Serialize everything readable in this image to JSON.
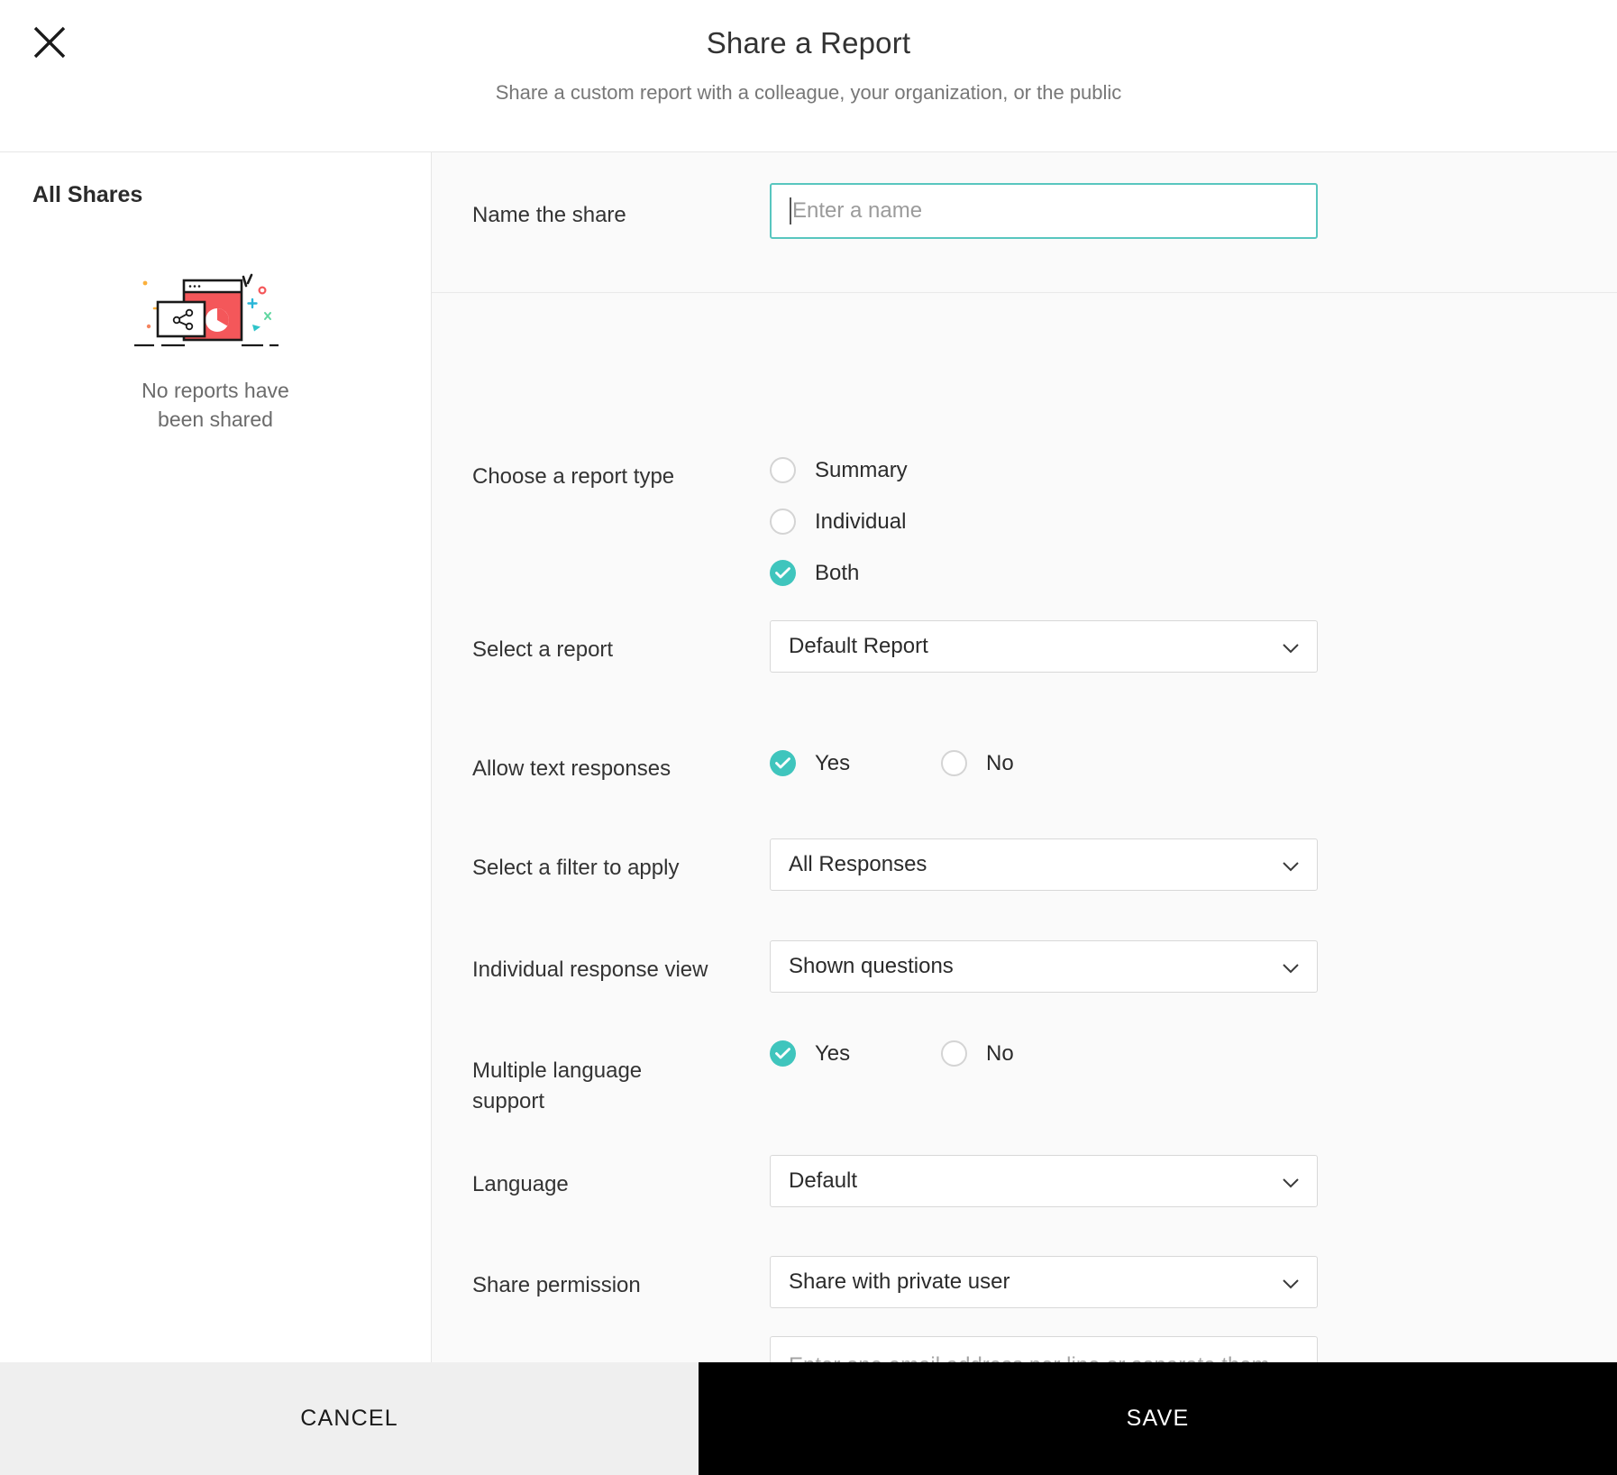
{
  "header": {
    "title": "Share a Report",
    "subtitle": "Share a custom report with a colleague, your organization, or the public",
    "close_icon": "close-icon"
  },
  "sidebar": {
    "title": "All Shares",
    "empty_line1": "No reports have",
    "empty_line2": "been shared",
    "illustration": "share-report-illustration"
  },
  "form": {
    "name": {
      "label": "Name the share",
      "value": "",
      "placeholder": "Enter a name"
    },
    "report_type": {
      "label": "Choose a report type",
      "options": [
        {
          "label": "Summary",
          "checked": false
        },
        {
          "label": "Individual",
          "checked": false
        },
        {
          "label": "Both",
          "checked": true
        }
      ]
    },
    "select_report": {
      "label": "Select a report",
      "value": "Default Report"
    },
    "allow_text_responses": {
      "label": "Allow text responses",
      "yes_label": "Yes",
      "no_label": "No",
      "selected": "Yes"
    },
    "select_filter": {
      "label": "Select a filter to apply",
      "value": "All Responses"
    },
    "individual_response_view": {
      "label": "Individual response view",
      "value": "Shown questions"
    },
    "multiple_language_support": {
      "label_line1": "Multiple language",
      "label_line2": "support",
      "yes_label": "Yes",
      "no_label": "No",
      "selected": "Yes"
    },
    "language": {
      "label": "Language",
      "value": "Default"
    },
    "share_permission": {
      "label": "Share permission",
      "value": "Share with private user"
    },
    "emails": {
      "value": "",
      "placeholder": "Enter one email address per line or separate them"
    }
  },
  "footer": {
    "cancel_label": "CANCEL",
    "save_label": "SAVE"
  },
  "colors": {
    "accent_teal": "#3fc5bd",
    "input_focus_border": "#58c6bf",
    "save_button_bg": "#000000",
    "cancel_button_bg": "#efefef",
    "illustration_red": "#f4575a"
  }
}
